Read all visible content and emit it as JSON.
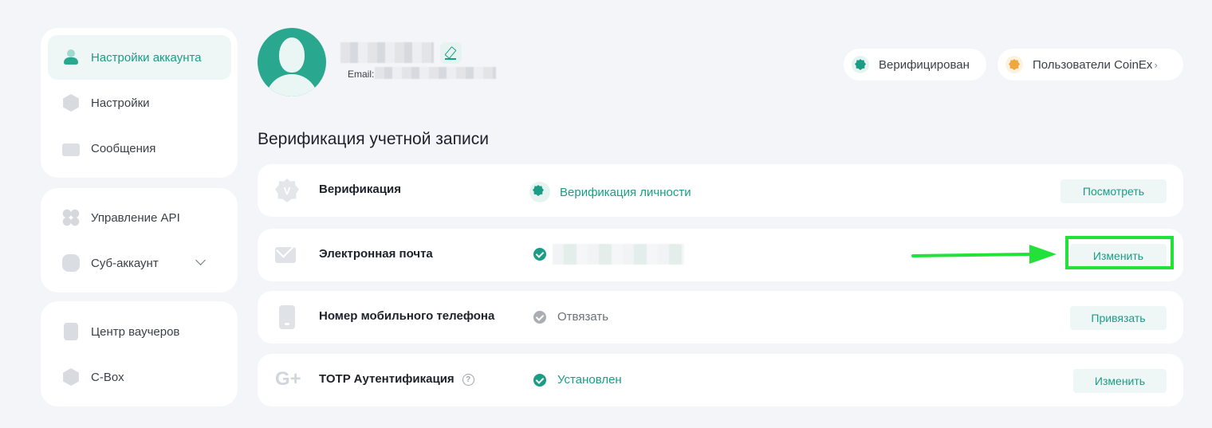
{
  "sidebar": {
    "group1": [
      {
        "label": "Настройки аккаунта",
        "icon": "account-icon",
        "active": true
      },
      {
        "label": "Настройки",
        "icon": "settings-icon"
      },
      {
        "label": "Сообщения",
        "icon": "messages-icon"
      }
    ],
    "group2": [
      {
        "label": "Управление API",
        "icon": "api-icon"
      },
      {
        "label": "Суб-аккаунт",
        "icon": "subaccount-icon",
        "expandable": true
      }
    ],
    "group3": [
      {
        "label": "Центр ваучеров",
        "icon": "voucher-icon"
      },
      {
        "label": "C-Box",
        "icon": "cbox-icon"
      }
    ]
  },
  "profile": {
    "email_label": "Email:",
    "verified_badge": "Верифицирован",
    "users_badge": "Пользователи CoinEx",
    "users_badge_arrow": "›"
  },
  "section_title": "Верификация учетной записи",
  "rows": [
    {
      "label": "Верификация",
      "status": "Верификация личности",
      "status_color": "#1b9c85",
      "button": "Посмотреть"
    },
    {
      "label": "Электронная почта",
      "status": "",
      "button": "Изменить"
    },
    {
      "label": "Номер мобильного телефона",
      "status": "Отвязать",
      "status_color": "#6b7079",
      "button": "Привязать"
    },
    {
      "label": "TOTP Аутентификация",
      "help": "?",
      "status": "Установлен",
      "status_color": "#1b9c85",
      "button": "Изменить"
    }
  ],
  "colors": {
    "accent": "#1b9c85",
    "annotation": "#22e23a"
  }
}
